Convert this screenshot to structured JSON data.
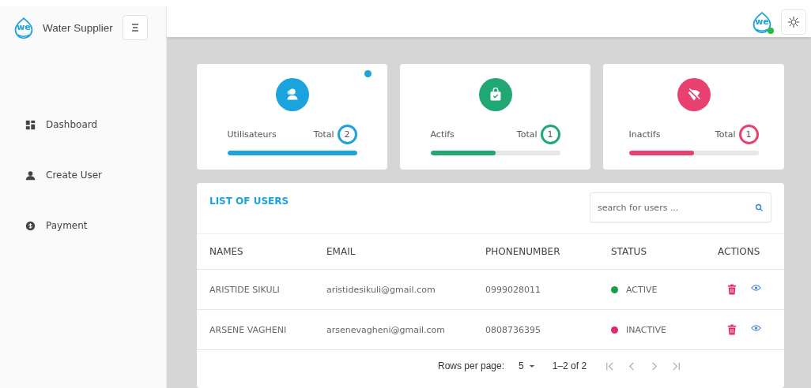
{
  "sidebar": {
    "logo_text": "we",
    "title": "Water Supplier",
    "items": [
      {
        "label": "Dashboard",
        "kind": "dashboard"
      },
      {
        "label": "Create User",
        "kind": "user"
      },
      {
        "label": "Payment",
        "kind": "payment"
      }
    ]
  },
  "header": {
    "avatar_text": "we",
    "online": true
  },
  "stats": [
    {
      "kind": "users",
      "label": "Utilisateurs",
      "total_label": "Total",
      "count": "2",
      "color": "#1aa3dd",
      "level": 1,
      "indicator": true
    },
    {
      "kind": "active",
      "label": "Actifs",
      "total_label": "Total",
      "count": "1",
      "color": "#1fa774",
      "level": 0.5,
      "indicator": false
    },
    {
      "kind": "inactive",
      "label": "Inactifs",
      "total_label": "Total",
      "count": "1",
      "color": "#e8416f",
      "level": 0.5,
      "indicator": false
    }
  ],
  "users": {
    "title": "LIST OF USERS",
    "search": {
      "placeholder": "search for users ..."
    },
    "columns": [
      "NAMES",
      "EMAIL",
      "PHONENUMBER",
      "STATUS",
      "ACTIONS"
    ],
    "rows": [
      {
        "name": "ARISTIDE SIKULI",
        "email": "aristidesikuli@gmail.com",
        "phone": "0999028011",
        "status": "ACTIVE",
        "color": "#1a9e4a"
      },
      {
        "name": "ARSENE VAGHENI",
        "email": "arsenevagheni@gmail.com",
        "phone": "0808736395",
        "status": "INACTIVE",
        "color": "#dd2a72"
      }
    ],
    "footer": {
      "rows_label": "Rows per page:",
      "rows_value": "5",
      "range": "1–2 of 2"
    }
  }
}
